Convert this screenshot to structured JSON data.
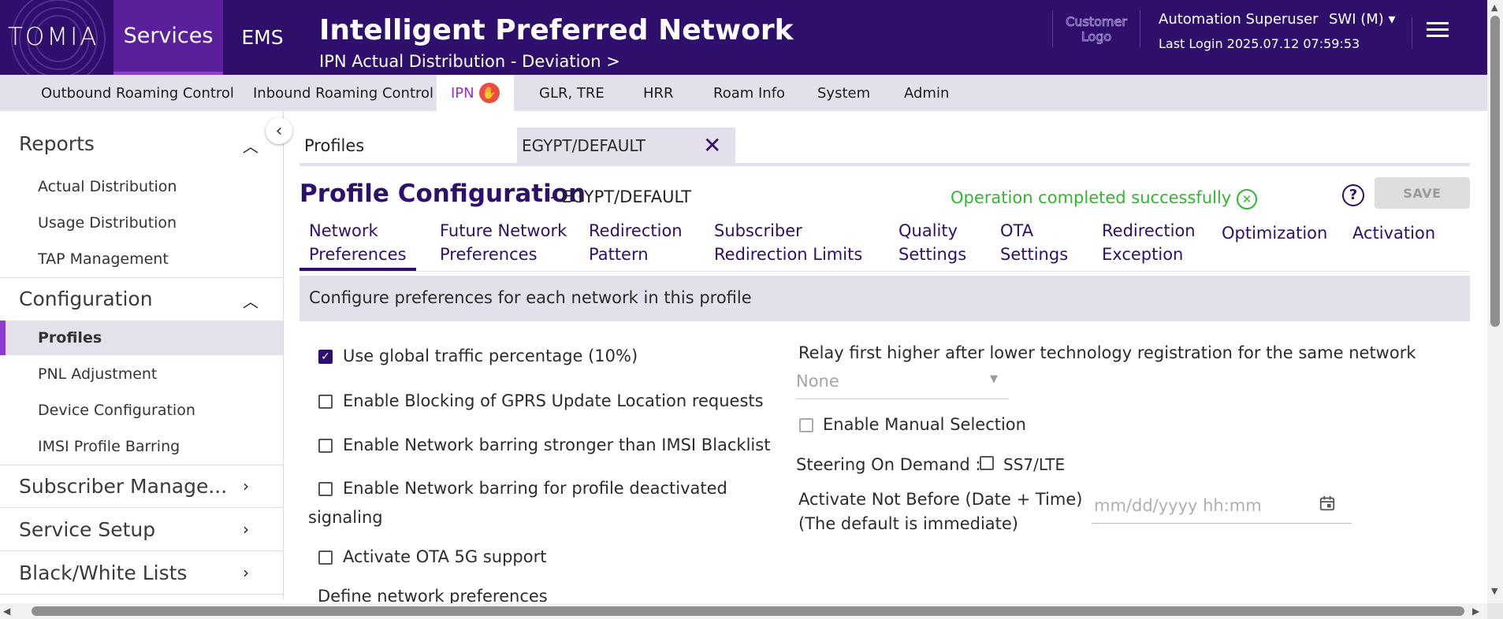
{
  "header": {
    "logo_text": "TOMIA",
    "nav": [
      "Services",
      "EMS"
    ],
    "title": "Intelligent Preferred Network",
    "subtitle": "IPN Actual Distribution - Deviation >",
    "customer_logo": "Customer Logo",
    "user_name": "Automation Superuser",
    "user_role": "SWI (M) ▾",
    "last_login": "Last Login 2025.07.12 07:59:53"
  },
  "module_tabs": [
    {
      "label": "Outbound Roaming Control"
    },
    {
      "label": "Inbound Roaming Control"
    },
    {
      "label": "IPN",
      "active": true
    },
    {
      "label": "GLR, TRE"
    },
    {
      "label": "HRR"
    },
    {
      "label": "Roam Info"
    },
    {
      "label": "System"
    },
    {
      "label": "Admin"
    }
  ],
  "sidebar": {
    "sections": [
      {
        "label": "Reports",
        "expanded": true,
        "items": [
          "Actual Distribution",
          "Usage Distribution",
          "TAP Management"
        ]
      },
      {
        "label": "Configuration",
        "expanded": true,
        "items": [
          "Profiles",
          "PNL Adjustment",
          "Device Configuration",
          "IMSI Profile Barring"
        ],
        "active_item": "Profiles"
      },
      {
        "label": "Subscriber Manage...",
        "expanded": false
      },
      {
        "label": "Service Setup",
        "expanded": false
      },
      {
        "label": "Black/White Lists",
        "expanded": false
      }
    ]
  },
  "breadcrumb": {
    "root": "Profiles",
    "chip": "EGYPT/DEFAULT"
  },
  "page": {
    "title": "Profile Configuration",
    "title_suffix": "- EGYPT/DEFAULT",
    "status_message": "Operation completed successfully",
    "save_label": "SAVE",
    "status_color": "#2eb82e",
    "accent_color": "#2e0f6b"
  },
  "subtabs": [
    {
      "label": "Network\nPreferences",
      "active": true
    },
    {
      "label": "Future Network\nPreferences"
    },
    {
      "label": "Redirection\nPattern"
    },
    {
      "label": "Subscriber\nRedirection Limits"
    },
    {
      "label": "Quality\nSettings"
    },
    {
      "label": "OTA\nSettings"
    },
    {
      "label": "Redirection\nException"
    },
    {
      "label": "Optimization"
    },
    {
      "label": "Activation"
    }
  ],
  "section_header": "Configure preferences for each network in this profile",
  "left_options": [
    {
      "label": "Use global traffic percentage (10%)",
      "checked": true
    },
    {
      "label": "Enable Blocking of GPRS Update Location requests",
      "checked": false
    },
    {
      "label": "Enable Network barring stronger than IMSI Blacklist",
      "checked": false
    },
    {
      "label": "Enable Network barring for profile deactivated",
      "checked": false
    },
    {
      "label": "Activate OTA 5G support",
      "checked": false
    }
  ],
  "left_option_wrap": "signaling",
  "define_label": "Define network preferences",
  "right": {
    "relay_label": "Relay first higher after lower technology registration for the same network",
    "relay_value": "None",
    "manual_selection_label": "Enable Manual Selection",
    "steering_label": "Steering On Demand :",
    "steering_option": "SS7/LTE",
    "activate_label_line1": "Activate Not Before (Date + Time)",
    "activate_label_line2": "(The default is immediate)",
    "date_placeholder": "mm/dd/yyyy hh:mm"
  }
}
